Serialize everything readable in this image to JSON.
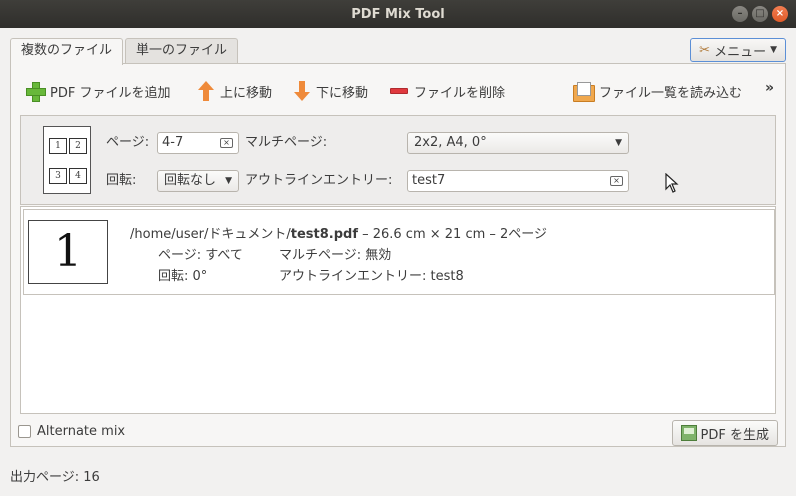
{
  "window": {
    "title": "PDF Mix Tool"
  },
  "tabs": [
    {
      "label": "複数のファイル",
      "active": true
    },
    {
      "label": "単一のファイル",
      "active": false
    }
  ],
  "menu": {
    "label": "メニュー"
  },
  "toolbar": {
    "add_label": "PDF ファイルを追加",
    "move_up_label": "上に移動",
    "move_down_label": "下に移動",
    "remove_label": "ファイルを削除",
    "load_label": "ファイル一覧を読み込む",
    "overflow": "»"
  },
  "editor": {
    "thumb_cells": [
      "1",
      "2",
      "3",
      "4"
    ],
    "pages_label": "ページ:",
    "pages_value": "4-7",
    "multipage_label": "マルチページ:",
    "multipage_value": "2x2, A4, 0°",
    "rotation_label": "回転:",
    "rotation_value": "回転なし",
    "outline_label": "アウトラインエントリー:",
    "outline_value": "test7"
  },
  "files": [
    {
      "thumb": "1",
      "path": "/home/user/ドキュメント/",
      "name": "test8.pdf",
      "info": " – 26.6 cm × 21 cm – 2ページ",
      "pages": "ページ: すべて",
      "multipage": "マルチページ: 無効",
      "rotation": "回転: 0°",
      "outline": "アウトラインエントリー: test8"
    }
  ],
  "footer": {
    "alternate_mix_label": "Alternate mix",
    "alternate_mix_checked": false,
    "generate_label": "PDF を生成"
  },
  "status": {
    "output_pages": "出力ページ: 16"
  },
  "colors": {
    "accent": "#5c8fd6",
    "close_button": "#e05a28"
  }
}
